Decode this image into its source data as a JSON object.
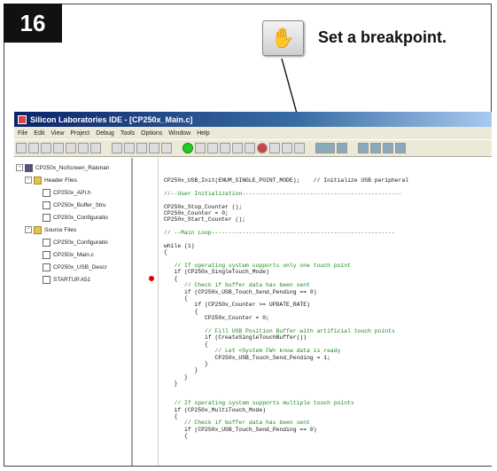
{
  "step": {
    "number": "16"
  },
  "callout": {
    "icon": "hand-pointer-icon",
    "text": "Set a breakpoint."
  },
  "ide": {
    "title": "Silicon Laboratories IDE - [CP250x_Main.c]",
    "menu": [
      "File",
      "Edit",
      "View",
      "Project",
      "Debug",
      "Tools",
      "Options",
      "Window",
      "Help"
    ],
    "tree": [
      {
        "label": "CP250x_NoScreen_Raionan",
        "type": "proj"
      },
      {
        "label": "Header Files",
        "type": "folder"
      },
      {
        "label": "CP250x_API.h",
        "type": "file"
      },
      {
        "label": "CP250x_Buffer_Stru",
        "type": "file"
      },
      {
        "label": "CP250x_Configuratio",
        "type": "file"
      },
      {
        "label": "Source Files",
        "type": "folder"
      },
      {
        "label": "CP250x_Configuratio",
        "type": "file"
      },
      {
        "label": "CP250x_Main.c",
        "type": "file"
      },
      {
        "label": "CP250x_USB_Descr",
        "type": "file"
      },
      {
        "label": "STARTUP.A51",
        "type": "file"
      }
    ],
    "code": [
      "CP250x_USB_Init(ENUM_SINGLE_POINT_MODE);    // Initialize USB peripheral",
      "",
      "//--User Initialization-----------------------------------------------",
      "",
      "CP250x_Stop_Counter ();",
      "CP250x_Counter = 0;",
      "CP250x_Start_Counter ();",
      "",
      "// --Main Loop------------------------------------------------------",
      "",
      "while (1)",
      "{",
      "",
      "   // If operating system supports only one touch point",
      "   if (CP250x_SingleTouch_Mode)",
      "   {",
      "      // Check if buffer data has been sent",
      "      if (CP250x_USB_Touch_Send_Pending == 0)",
      "      {",
      "         if (CP250x_Counter >= UPDATE_RATE)",
      "         {",
      "            CP250x_Counter = 0;",
      "",
      "            // Fill USB Position Buffer with artificial touch points",
      "            if (CreateSingleTouchBuffer())",
      "            {",
      "               // Let <System FW> know data is ready",
      "               CP250x_USB_Touch_Send_Pending = 1;",
      "            }",
      "         }",
      "      }",
      "   }",
      "",
      "",
      "   // If operating system supports multiple touch points",
      "   if (CP250x_MultiTouch_Mode)",
      "   {",
      "      // Check if buffer data has been sent",
      "      if (CP250x_USB_Touch_Send_Pending == 0)",
      "      {"
    ]
  },
  "colors": {
    "breakpoint": "#dd0000",
    "comment": "#1a8a1a",
    "titlebar": "#0a246a"
  }
}
